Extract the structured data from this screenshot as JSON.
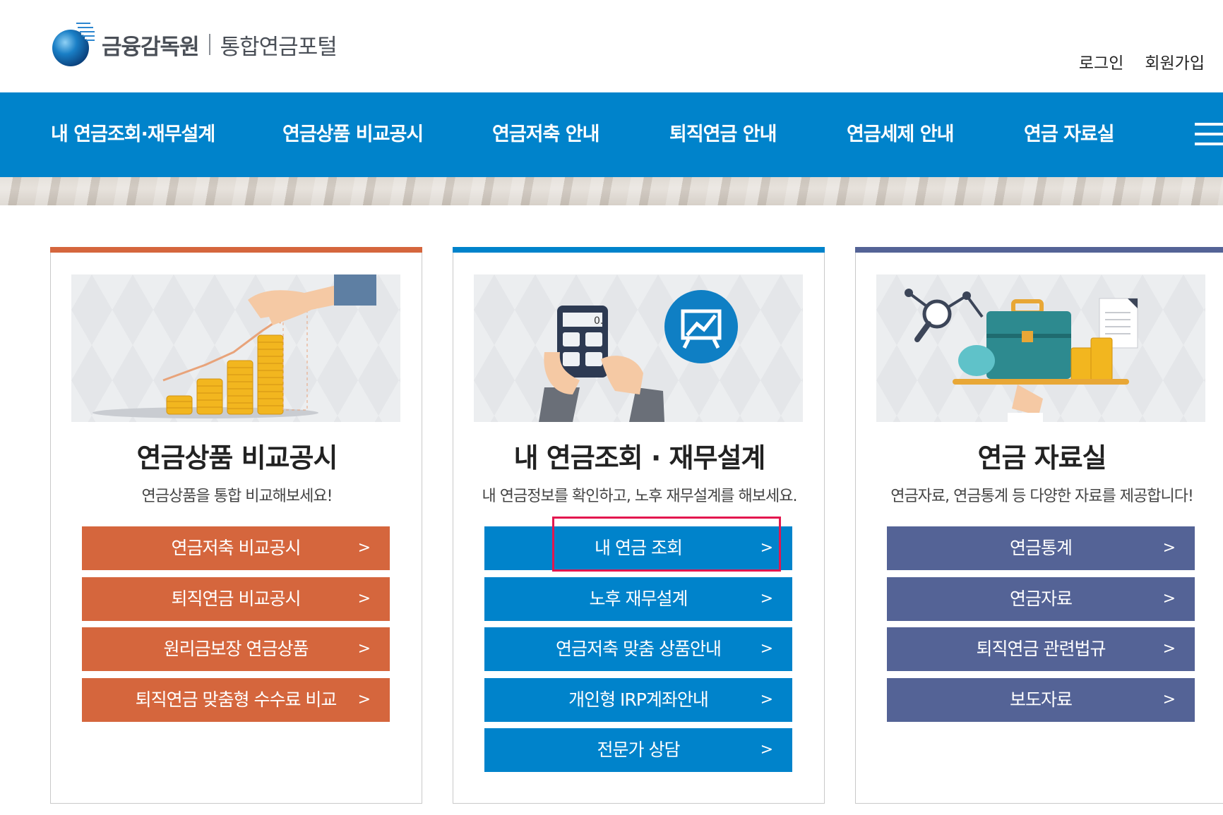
{
  "header": {
    "org_name": "금융감독원",
    "portal_name": "통합연금포털",
    "login": "로그인",
    "signup": "회원가입"
  },
  "nav": {
    "items": [
      "내 연금조회·재무설계",
      "연금상품 비교공시",
      "연금저축 안내",
      "퇴직연금 안내",
      "연금세제 안내",
      "연금 자료실"
    ]
  },
  "colors": {
    "primary_blue": "#0083cb",
    "orange": "#d5663d",
    "slate": "#546396",
    "highlight": "#e3174f"
  },
  "cards": [
    {
      "title": "연금상품 비교공시",
      "desc": "연금상품을 통합 비교해보세요!",
      "buttons": [
        "연금저축 비교공시",
        "퇴직연금 비교공시",
        "원리금보장 연금상품",
        "퇴직연금 맞춤형 수수료 비교"
      ]
    },
    {
      "title": "내 연금조회 · 재무설계",
      "desc": "내 연금정보를 확인하고, 노후 재무설계를 해보세요.",
      "buttons": [
        "내 연금 조회",
        "노후 재무설계",
        "연금저축 맞춤 상품안내",
        "개인형 IRP계좌안내",
        "전문가 상담"
      ]
    },
    {
      "title": "연금 자료실",
      "desc": "연금자료, 연금통계 등 다양한 자료를 제공합니다!",
      "buttons": [
        "연금통계",
        "연금자료",
        "퇴직연금 관련법규",
        "보도자료"
      ]
    }
  ],
  "chevron": ">"
}
